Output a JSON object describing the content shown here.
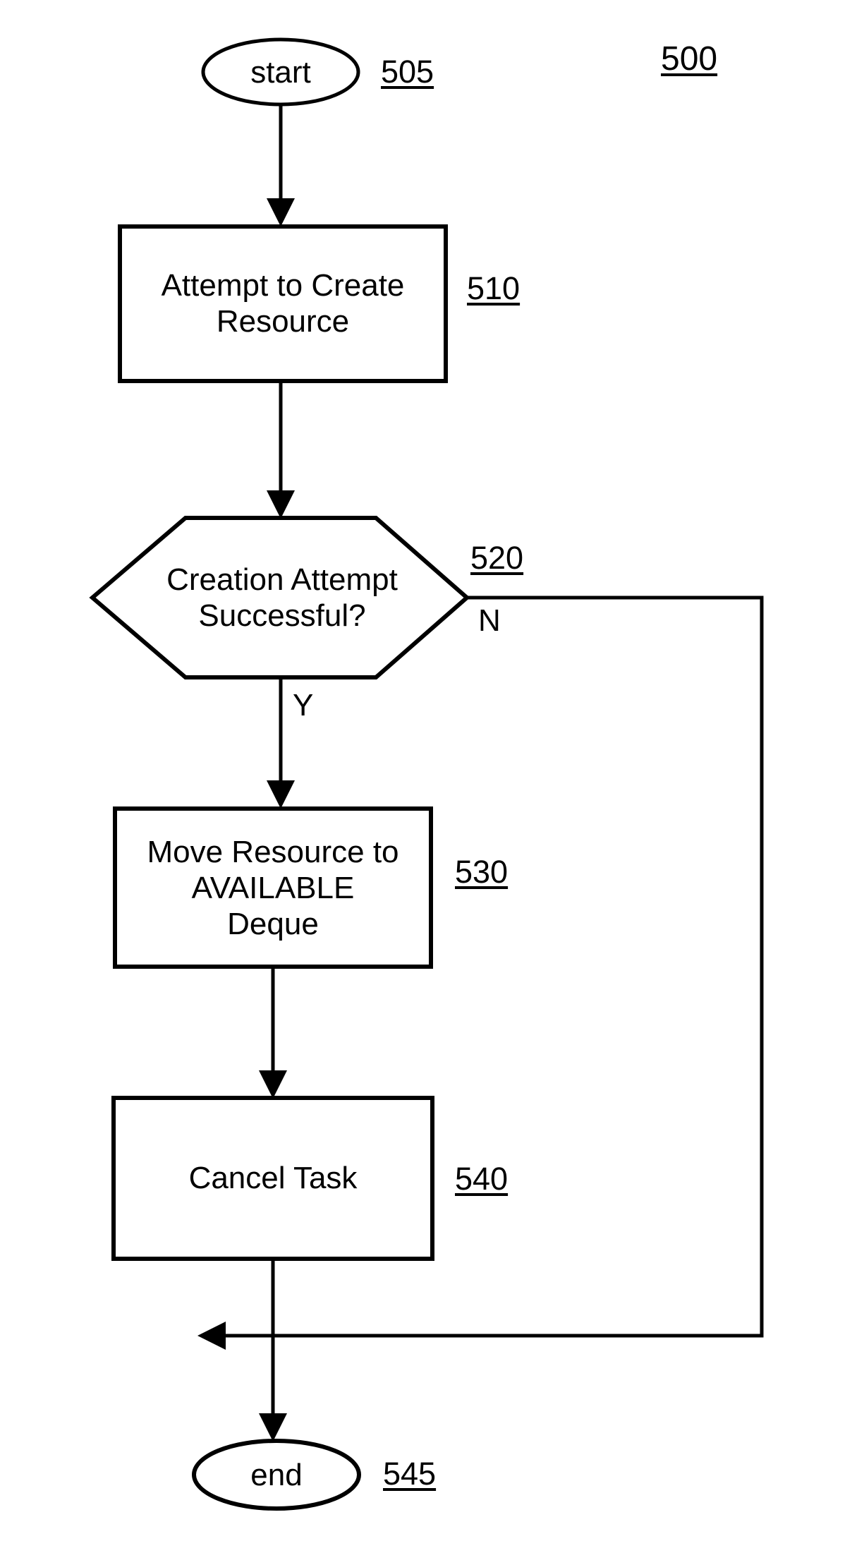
{
  "figure": {
    "number": "500",
    "type": "flowchart"
  },
  "nodes": {
    "start": {
      "label": "start",
      "ref": "505",
      "shape": "ellipse"
    },
    "create": {
      "label": "Attempt to Create\nResource",
      "ref": "510",
      "shape": "process"
    },
    "decision": {
      "label": "Creation Attempt\nSuccessful?",
      "ref": "520",
      "shape": "hexagon"
    },
    "move": {
      "label": "Move Resource to\nAVAILABLE\nDeque",
      "ref": "530",
      "shape": "process"
    },
    "cancel": {
      "label": "Cancel Task",
      "ref": "540",
      "shape": "process"
    },
    "end": {
      "label": "end",
      "ref": "545",
      "shape": "ellipse"
    }
  },
  "edges": {
    "yes_label": "Y",
    "no_label": "N"
  },
  "chart_data": {
    "type": "diagram",
    "title": "500",
    "nodes": [
      {
        "id": "505",
        "text": "start",
        "shape": "terminator"
      },
      {
        "id": "510",
        "text": "Attempt to Create Resource",
        "shape": "process"
      },
      {
        "id": "520",
        "text": "Creation Attempt Successful?",
        "shape": "decision"
      },
      {
        "id": "530",
        "text": "Move Resource to AVAILABLE Deque",
        "shape": "process"
      },
      {
        "id": "540",
        "text": "Cancel Task",
        "shape": "process"
      },
      {
        "id": "545",
        "text": "end",
        "shape": "terminator"
      }
    ],
    "links": [
      {
        "from": "505",
        "to": "510",
        "label": ""
      },
      {
        "from": "510",
        "to": "520",
        "label": ""
      },
      {
        "from": "520",
        "to": "530",
        "label": "Y"
      },
      {
        "from": "520",
        "to": "545",
        "label": "N"
      },
      {
        "from": "530",
        "to": "540",
        "label": ""
      },
      {
        "from": "540",
        "to": "545",
        "label": ""
      }
    ]
  }
}
